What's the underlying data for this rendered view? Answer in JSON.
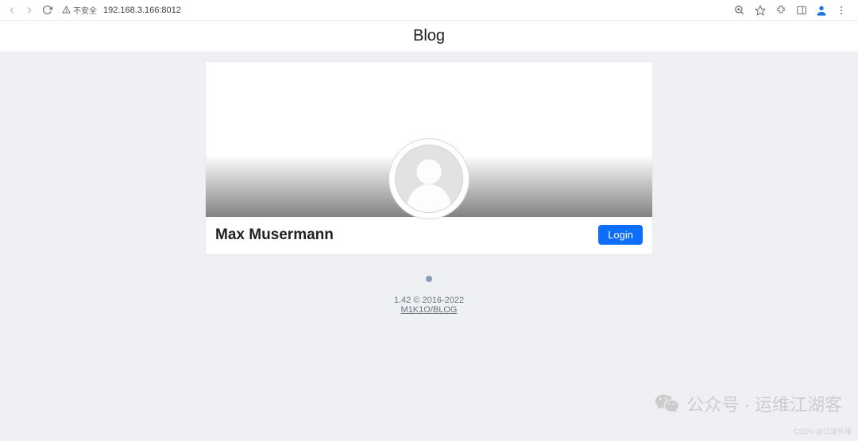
{
  "browser": {
    "security_label": "不安全",
    "url": "192.168.3.166:8012"
  },
  "header": {
    "title": "Blog"
  },
  "profile": {
    "name": "Max Musermann",
    "login_label": "Login"
  },
  "footer": {
    "version_line": "1.42 © 2016-2022",
    "link_text": "M1K1O/BLOG"
  },
  "watermark": {
    "wechat": "公众号 · 运维江湖客",
    "csdn": "CSDN @江湖有缘"
  }
}
